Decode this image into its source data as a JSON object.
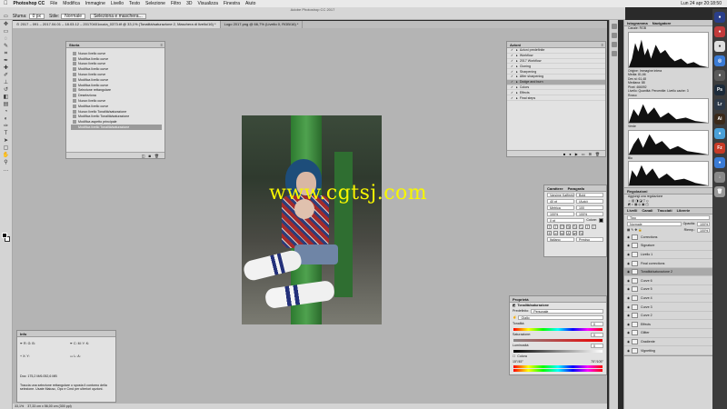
{
  "menubar": {
    "app": "Photoshop CC",
    "items": [
      "File",
      "Modifica",
      "Immagine",
      "Livello",
      "Testo",
      "Selezione",
      "Filtro",
      "3D",
      "Visualizza",
      "Finestra",
      "Aiuto"
    ],
    "clock": "Lun 24 apr 20:18:50"
  },
  "window": {
    "title": "Adobe Photoshop CC 2017"
  },
  "options": {
    "sfuma_label": "Sfuma:",
    "sfuma_value": "0 px",
    "stile_label": "Stile:",
    "stile_value": "Normale",
    "select_mask_label": "Seleziona e maschera..."
  },
  "tabs": [
    "⊙ 2017 – 091 – 2017.04.01 – 18.03.12 – 20170401cucia_0373.tif @ 33,1% (Tonalità/saturazione 2, Maschera di livello/16) *",
    "Logo 2017.png @ 66,7% (Livello 0, RGB/16) *"
  ],
  "history": {
    "title": "Storia",
    "items": [
      "Nuovo livello curve",
      "Modifica livello curve",
      "Nuovo livello curve",
      "Modifica livello curve",
      "Nuovo livello curve",
      "Modifica livello curve",
      "Modifica livello curve",
      "Selezione rettangolare",
      "Deseleziona",
      "Nuovo livello curve",
      "Modifica livello curve",
      "Nuovo livello Tonalità/saturazione",
      "Modifica livello Tonalità/saturazione",
      "Modifica aspetto principale",
      "Modifica livello Tonalità/saturazione"
    ],
    "selected_index": 14
  },
  "actions": {
    "title": "Azioni",
    "items": [
      "Azioni predefinite",
      "Workflow",
      "2017 Workflow",
      "Cloning",
      "Sharpening",
      "After sharpening",
      "Dodge and burn",
      "Colors",
      "Effects",
      "Final steps"
    ],
    "selected_index": 6
  },
  "character": {
    "tabs": [
      "Carattere",
      "Paragrafo"
    ],
    "font": "Varsime Kaffeeklapp",
    "style": "Bold",
    "size": "40 pt",
    "leading": "(Auto)",
    "kerning": "Metrica",
    "tracking": "100",
    "vscale": "100%",
    "hscale": "100%",
    "baseline": "0 pt",
    "color_label": "Colore:",
    "language": "Italiano",
    "aa": "Preciso"
  },
  "properties": {
    "title": "Proprietà",
    "subtitle": "Tonalità/saturazione",
    "preset_label": "Predefinito:",
    "preset_value": "Personale",
    "channel": "Giallo",
    "hue_label": "Tonalità:",
    "hue_value": "0",
    "sat_label": "Saturazione:",
    "sat_value": "0",
    "light_label": "Luminosità:",
    "light_value": "0",
    "colorize": "Colora",
    "range_left": "15°/45°",
    "range_right": "75°/105°"
  },
  "info": {
    "title": "Info",
    "doc": "Doc: 175,2 M/6.052,6 MB",
    "hint": "Traccia una selezione rettangolare o sposta il contorno della selezione. Usate Maiusc, Opz e Cmd per ulteriori opzioni."
  },
  "histogram": {
    "tabs": [
      "Istogramma",
      "Navigatore"
    ],
    "channel_label": "Canale:",
    "channel_value": "RGB",
    "source_label": "Origine:",
    "source_value": "Immagine intera",
    "stats": [
      "Media: 81,66",
      "Dev st: 61,48",
      "Mediana: 88",
      "Pixel: 466092"
    ],
    "stats_right": [
      "Livello:",
      "Quantità:",
      "Percentile:",
      "Livello cache: 3"
    ],
    "labels": [
      "Rosso",
      "Verde",
      "Blu"
    ]
  },
  "adjustments": {
    "title": "Regolazioni",
    "subtitle": "Aggiungi una regolazione"
  },
  "layers": {
    "tabs": [
      "Livelli",
      "Canali",
      "Tracciati",
      "Librerie"
    ],
    "filter": "Tipo",
    "blend": "Normale",
    "opacity_label": "Opacità:",
    "opacity_value": "100%",
    "fill_label": "Riemp.:",
    "fill_value": "100%",
    "items": [
      "Corrections",
      "Signature",
      "Livello 1",
      "Final corrections",
      "Tonalità/saturazione 2",
      "Curve 6",
      "Curve 5",
      "Curve 4",
      "Curve 3",
      "Curve 2",
      "Effects",
      "Glitter",
      "Gradiente",
      "Vignetting"
    ],
    "selected_index": 4
  },
  "status": {
    "zoom": "33,1%",
    "size": "37,33 cm x 56,00 cm (300 ppi)"
  },
  "watermark": "www.cgtsj.com",
  "mac_dock": [
    "Ps",
    "Lr",
    "Ai",
    "Fz"
  ],
  "colors": {
    "accent": "#f7f700",
    "panel": "#e2e2e2",
    "canvas": "#b4b4b4"
  }
}
